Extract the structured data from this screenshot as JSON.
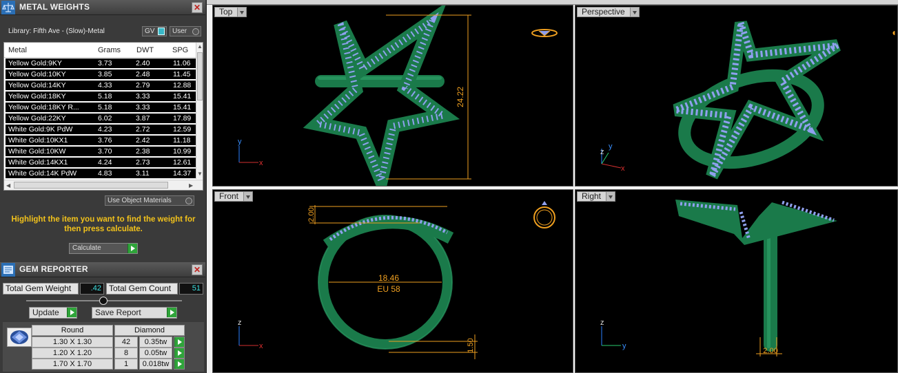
{
  "metal_weights": {
    "title": "METAL WEIGHTS",
    "library_label": "Library: Fifth Ave - (Slow)-Metal",
    "gv_label": "GV",
    "user_label": "User",
    "columns": [
      "Metal",
      "Grams",
      "DWT",
      "SPG"
    ],
    "rows": [
      [
        "Yellow Gold:9KY",
        "3.73",
        "2.40",
        "11.06"
      ],
      [
        "Yellow Gold:10KY",
        "3.85",
        "2.48",
        "11.45"
      ],
      [
        "Yellow Gold:14KY",
        "4.33",
        "2.79",
        "12.88"
      ],
      [
        "Yellow Gold:18KY",
        "5.18",
        "3.33",
        "15.41"
      ],
      [
        "Yellow Gold:18KY R...",
        "5.18",
        "3.33",
        "15.41"
      ],
      [
        "Yellow Gold:22KY",
        "6.02",
        "3.87",
        "17.89"
      ],
      [
        "White Gold:9K PdW",
        "4.23",
        "2.72",
        "12.59"
      ],
      [
        "White Gold:10KX1",
        "3.76",
        "2.42",
        "11.18"
      ],
      [
        "White Gold:10KW",
        "3.70",
        "2.38",
        "10.99"
      ],
      [
        "White Gold:14KX1",
        "4.24",
        "2.73",
        "12.61"
      ],
      [
        "White Gold:14K PdW",
        "4.83",
        "3.11",
        "14.37"
      ]
    ],
    "use_object_materials": "Use Object Materials",
    "hint": "Highlight the item you want to find the weight for then press calculate.",
    "calculate": "Calculate"
  },
  "gem_reporter": {
    "title": "GEM REPORTER",
    "total_weight_label": "Total Gem Weight",
    "total_weight_value": ".42",
    "total_count_label": "Total Gem Count",
    "total_count_value": "51",
    "update": "Update",
    "save_report": "Save Report",
    "shape": "Round",
    "material": "Diamond",
    "rows": [
      [
        "1.30 X 1.30",
        "42",
        "0.35tw"
      ],
      [
        "1.20 X 1.20",
        "8",
        "0.05tw"
      ],
      [
        "1.70 X 1.70",
        "1",
        "0.018tw"
      ]
    ]
  },
  "viewports": {
    "top": {
      "label": "Top",
      "dimension": "24.22"
    },
    "perspective": {
      "label": "Perspective"
    },
    "front": {
      "label": "Front",
      "dim_top": "2.00",
      "diameter": "18.46",
      "size": "EU 58",
      "dim_bottom": "1.50"
    },
    "right": {
      "label": "Right",
      "dim_bottom": "2.00"
    }
  },
  "axes": {
    "x": "x",
    "y": "y",
    "z": "z"
  },
  "colors": {
    "ring_green": "#1a7a4a",
    "gem_blue": "#8fa0ee",
    "dim_orange": "#f0a020",
    "hint_yellow": "#f2c21b"
  }
}
